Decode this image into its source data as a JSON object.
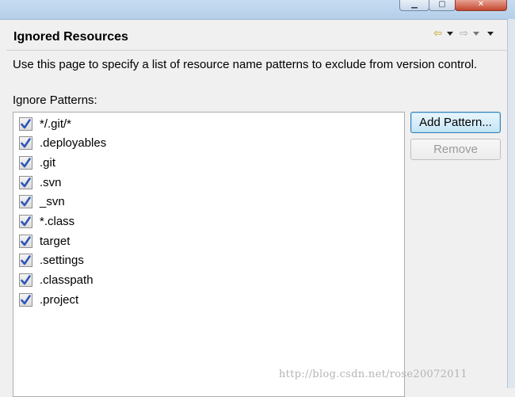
{
  "window": {
    "controls": {
      "minimize_glyph": "▁",
      "maximize_glyph": "▢",
      "close_glyph": "✕"
    }
  },
  "header": {
    "title": "Ignored Resources",
    "icons": [
      "back-arrow-icon",
      "dropdown-icon",
      "forward-arrow-icon",
      "dropdown-icon",
      "view-menu-icon"
    ],
    "back_glyph": "⇦",
    "forward_glyph": "⇨"
  },
  "description": "Use this page to specify a list of resource name patterns to exclude from version control.",
  "patterns_label": "Ignore Patterns:",
  "patterns": [
    {
      "label": "*/.git/*",
      "checked": true
    },
    {
      "label": ".deployables",
      "checked": true
    },
    {
      "label": ".git",
      "checked": true
    },
    {
      "label": ".svn",
      "checked": true
    },
    {
      "label": "_svn",
      "checked": true
    },
    {
      "label": "*.class",
      "checked": true
    },
    {
      "label": "target",
      "checked": true
    },
    {
      "label": ".settings",
      "checked": true
    },
    {
      "label": ".classpath",
      "checked": true
    },
    {
      "label": ".project",
      "checked": true
    }
  ],
  "buttons": {
    "add_pattern": "Add Pattern...",
    "remove": "Remove"
  },
  "watermark": "http://blog.csdn.net/rose20072011",
  "colors": {
    "check": "#2f56b8",
    "accent_button": "#3c7fb1"
  }
}
